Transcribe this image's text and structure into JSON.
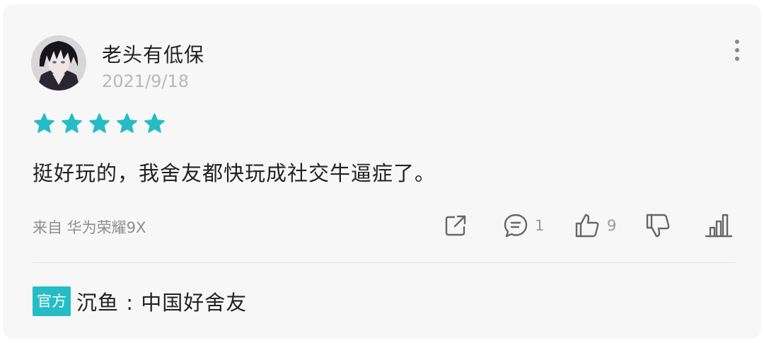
{
  "review": {
    "username": "老头有低保",
    "date": "2021/9/18",
    "rating": 5,
    "rating_max": 5,
    "text": "挺好玩的，我舍友都快玩成社交牛逼症了。",
    "device": "来自 华为荣耀9X"
  },
  "actions": {
    "share_icon": "share-icon",
    "comment_count": "1",
    "like_count": "9"
  },
  "official_reply": {
    "badge": "官方",
    "text": "沉鱼 : 中国好舍友"
  },
  "colors": {
    "accent": "#26bcc6",
    "background": "#f7f7f8",
    "muted_text": "#8e8e8e"
  }
}
